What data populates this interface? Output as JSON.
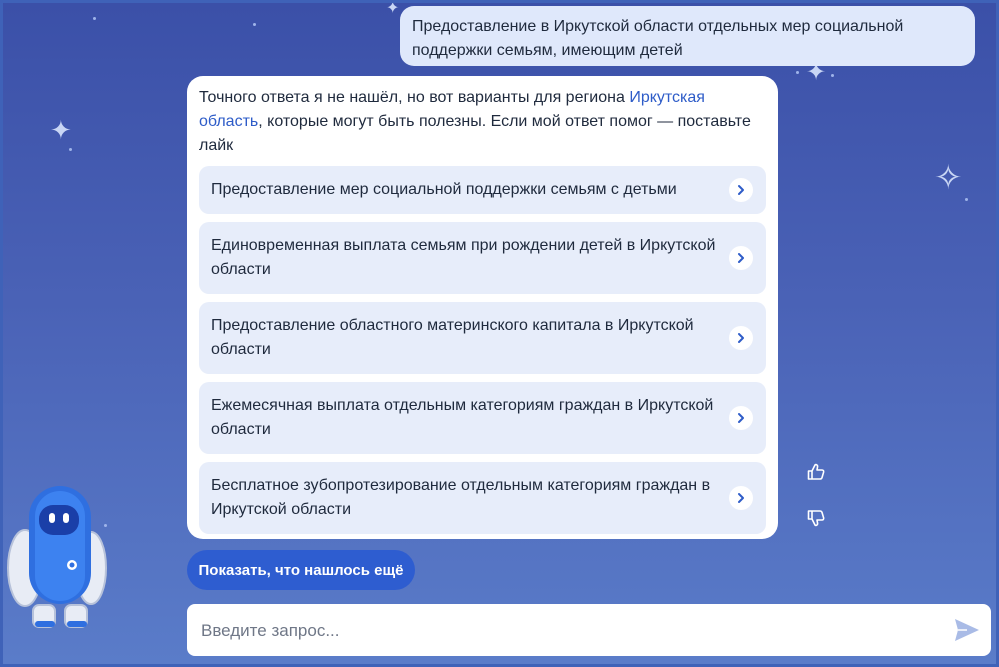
{
  "chat": {
    "user_message": "Предоставление в Иркутской области отдельных мер социальной поддержки семьям, имеющим детей",
    "bot_intro_before": "Точного ответа я не нашёл, но вот варианты для региона ",
    "bot_intro_link": "Иркутская область",
    "bot_intro_after": ", которые могут быть полезны. Если мой ответ помог — поставьте лайк",
    "options": [
      {
        "label": "Предоставление мер социальной поддержки семьям с детьми"
      },
      {
        "label": "Единовременная выплата семьям при рождении детей в Иркутской области"
      },
      {
        "label": "Предоставление областного материнского капитала в Иркутской области"
      },
      {
        "label": "Ежемесячная выплата отдельным категориям граждан в Иркутской области"
      },
      {
        "label": "Бесплатное зубопротезирование отдельным категориям граждан в Иркутской области"
      }
    ],
    "more_button": "Показать, что нашлось ещё"
  },
  "input": {
    "placeholder": "Введите запрос..."
  },
  "icons": {
    "option_arrow": "chevron-right-icon",
    "like": "thumbs-up-icon",
    "dislike": "thumbs-down-icon",
    "send": "send-icon",
    "assistant": "robot-mascot"
  },
  "colors": {
    "accent": "#2e5dd0",
    "background": "#4a62b6",
    "option_bg": "#e7edfa",
    "user_bubble": "#dfe8fb"
  }
}
